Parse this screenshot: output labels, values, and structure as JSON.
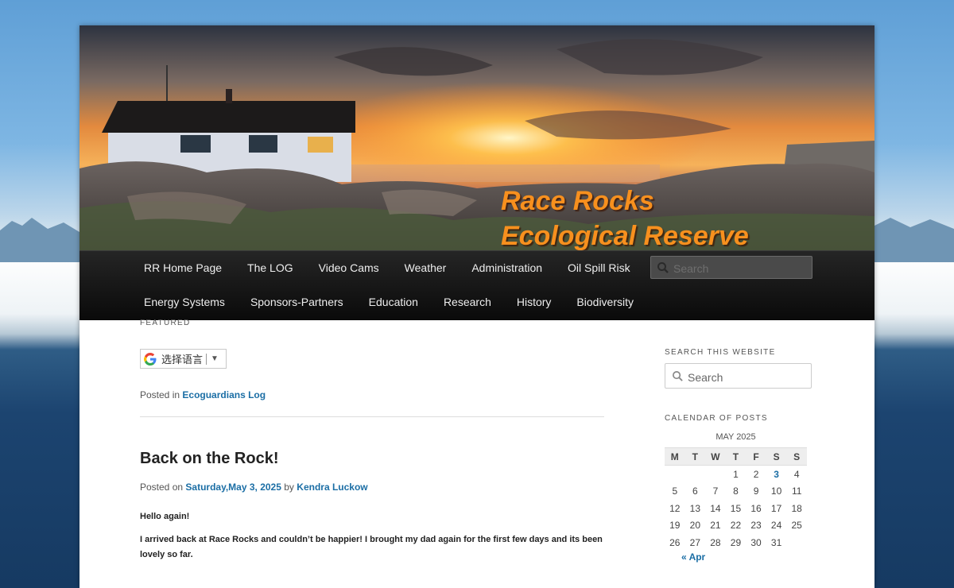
{
  "site": {
    "title_line1": "Race Rocks",
    "title_line2": "Ecological Reserve"
  },
  "nav": {
    "row1": [
      "RR Home Page",
      "The LOG",
      "Video Cams",
      "Weather",
      "Administration",
      "Oil Spill Risk"
    ],
    "row2": [
      "Energy Systems",
      "Sponsors-Partners",
      "Education",
      "Research",
      "History",
      "Biodiversity"
    ],
    "search_placeholder": "Search"
  },
  "content": {
    "featured_label": "FEATURED",
    "translate_label": "选择语言",
    "translate_arrow": "▼",
    "posted_in_prefix": "Posted in",
    "posted_in_category": "Ecoguardians Log",
    "post": {
      "title": "Back on the Rock!",
      "posted_on_prefix": "Posted on",
      "date": "Saturday,May 3, 2025",
      "by": "by",
      "author": "Kendra Luckow",
      "paragraph1": "Hello again!",
      "paragraph2": "I arrived back at Race Rocks and couldn’t be happier! I brought my dad again for the first few days and its been lovely so far."
    }
  },
  "sidebar": {
    "search_title": "SEARCH THIS WEBSITE",
    "search_placeholder": "Search",
    "calendar_title": "CALENDAR OF POSTS",
    "calendar": {
      "caption": "MAY 2025",
      "days": [
        "M",
        "T",
        "W",
        "T",
        "F",
        "S",
        "S"
      ],
      "weeks": [
        [
          "",
          "",
          "",
          "1",
          "2",
          "3",
          "4"
        ],
        [
          "5",
          "6",
          "7",
          "8",
          "9",
          "10",
          "11"
        ],
        [
          "12",
          "13",
          "14",
          "15",
          "16",
          "17",
          "18"
        ],
        [
          "19",
          "20",
          "21",
          "22",
          "23",
          "24",
          "25"
        ],
        [
          "26",
          "27",
          "28",
          "29",
          "30",
          "31",
          ""
        ]
      ],
      "linked_days": [
        "3"
      ],
      "prev_link": "« Apr"
    }
  },
  "colors": {
    "title_orange": "#f7901e",
    "link_blue": "#1b6ea5",
    "nav_bg": "#111111"
  }
}
